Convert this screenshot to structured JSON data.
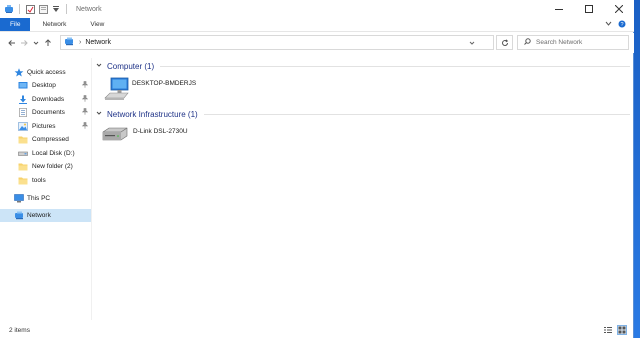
{
  "window": {
    "title": "Network"
  },
  "ribbon": {
    "tabs": [
      "File",
      "Network",
      "View"
    ]
  },
  "address": {
    "path": "Network"
  },
  "search": {
    "placeholder": "Search Network"
  },
  "nav_pane": {
    "quick_access_label": "Quick access",
    "quick_access_items": [
      {
        "label": "Desktop",
        "icon": "desktop-folder-icon",
        "pinned": true
      },
      {
        "label": "Downloads",
        "icon": "downloads-icon",
        "pinned": true
      },
      {
        "label": "Documents",
        "icon": "documents-icon",
        "pinned": true
      },
      {
        "label": "Pictures",
        "icon": "pictures-icon",
        "pinned": true
      },
      {
        "label": "Compressed",
        "icon": "folder-icon",
        "pinned": false
      },
      {
        "label": "Local Disk (D:)",
        "icon": "drive-icon",
        "pinned": false
      },
      {
        "label": "New folder (2)",
        "icon": "folder-icon",
        "pinned": false
      },
      {
        "label": "tools",
        "icon": "folder-icon",
        "pinned": false
      }
    ],
    "this_pc_label": "This PC",
    "network_label": "Network"
  },
  "content": {
    "groups": [
      {
        "header": "Computer (1)",
        "items": [
          {
            "label": "DESKTOP-BMDERJS",
            "icon": "computer-icon"
          }
        ]
      },
      {
        "header": "Network Infrastructure (1)",
        "items": [
          {
            "label": "D-Link DSL-2730U",
            "icon": "router-icon"
          }
        ]
      }
    ]
  },
  "status": {
    "item_count": "2 items"
  },
  "colors": {
    "accent": "#1a6ad0",
    "group_header": "#1e3287",
    "selection": "#cce4f7",
    "desktop": "#1e6fd9"
  }
}
